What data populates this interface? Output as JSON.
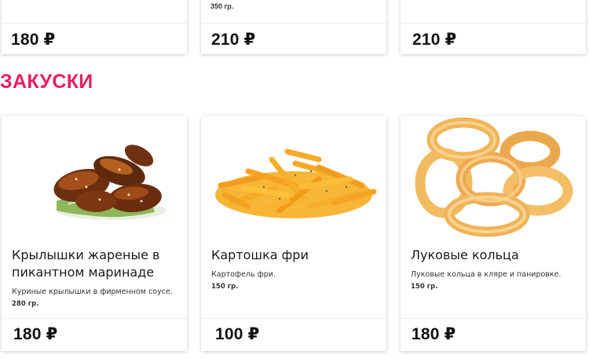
{
  "top_row": [
    {
      "price": "180 ₽",
      "weight": ""
    },
    {
      "price": "210 ₽",
      "weight": "350 гр."
    },
    {
      "price": "210 ₽",
      "weight": ""
    }
  ],
  "section": {
    "title": "ЗАКУСКИ"
  },
  "products": [
    {
      "name_line1": "Крылышки жареные в",
      "name_line2": "пикантном маринаде",
      "description": "Куриные крылышки в фирменном соусе.",
      "weight": "280 гр.",
      "price": "180 ₽",
      "image_icon": "chicken-wings-image"
    },
    {
      "name_line1": "Картошка фри",
      "name_line2": "",
      "description": "Картофель фри.",
      "weight": "150 гр.",
      "price": "100 ₽",
      "image_icon": "french-fries-image"
    },
    {
      "name_line1": "Луковые кольца",
      "name_line2": "",
      "description": "Луковые кольца в кляре и панировке.",
      "weight": "150 гр.",
      "price": "180 ₽",
      "image_icon": "onion-rings-image"
    }
  ],
  "colors": {
    "accent": "#e5215f"
  }
}
